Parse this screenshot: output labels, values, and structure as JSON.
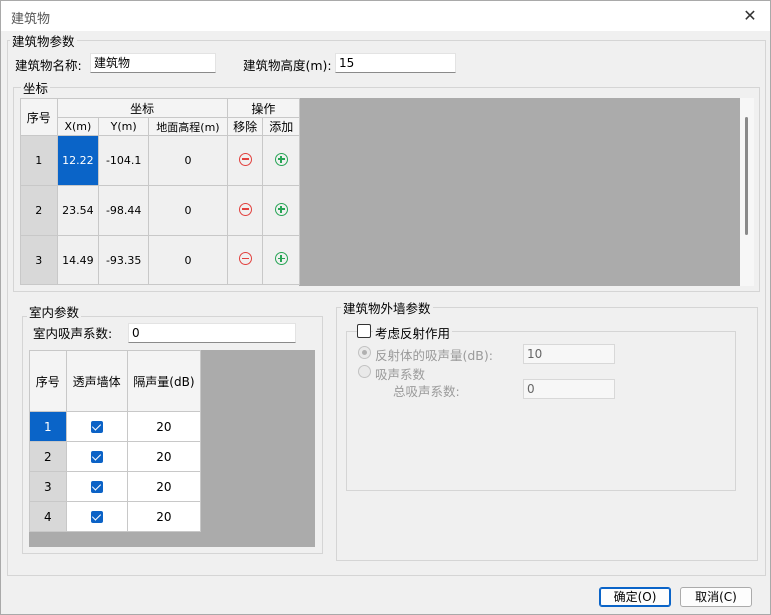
{
  "window": {
    "title": "建筑物",
    "close_glyph": "✕"
  },
  "params": {
    "group_label": "建筑物参数",
    "name_label": "建筑物名称:",
    "name_value": "建筑物",
    "height_label": "建筑物高度(m):",
    "height_value": "15"
  },
  "coords": {
    "group_label": "坐标",
    "headers": {
      "seq": "序号",
      "coord": "坐标",
      "ops": "操作",
      "x": "X(m)",
      "y": "Y(m)",
      "ground": "地面高程(m)",
      "remove": "移除",
      "add": "添加"
    },
    "rows": [
      {
        "seq": "1",
        "x": "12.22",
        "y": "-104.1",
        "ground": "0"
      },
      {
        "seq": "2",
        "x": "23.54",
        "y": "-98.44",
        "ground": "0"
      },
      {
        "seq": "3",
        "x": "14.49",
        "y": "-93.35",
        "ground": "0"
      }
    ]
  },
  "indoor": {
    "group_label": "室内参数",
    "absorb_label": "室内吸声系数:",
    "absorb_value": "0",
    "headers": {
      "seq": "序号",
      "wall": "透声墙体",
      "insulation": "隔声量(dB)"
    },
    "rows": [
      {
        "seq": "1",
        "checked": true,
        "insulation": "20"
      },
      {
        "seq": "2",
        "checked": true,
        "insulation": "20"
      },
      {
        "seq": "3",
        "checked": true,
        "insulation": "20"
      },
      {
        "seq": "4",
        "checked": true,
        "insulation": "20"
      }
    ]
  },
  "exterior": {
    "group_label": "建筑物外墙参数",
    "reflect_label": "考虑反射作用",
    "reflect_checked": false,
    "absorb_amount_label": "反射体的吸声量(dB):",
    "absorb_amount_value": "10",
    "absorb_coef_label": "吸声系数",
    "total_absorb_label": "总吸声系数:",
    "total_absorb_value": "0"
  },
  "buttons": {
    "ok": "确定(O)",
    "cancel": "取消(C)"
  },
  "colors": {
    "selection": "#0a64c8",
    "remove_icon": "#e2413e",
    "add_icon": "#27a455",
    "empty_area": "#ababab"
  }
}
